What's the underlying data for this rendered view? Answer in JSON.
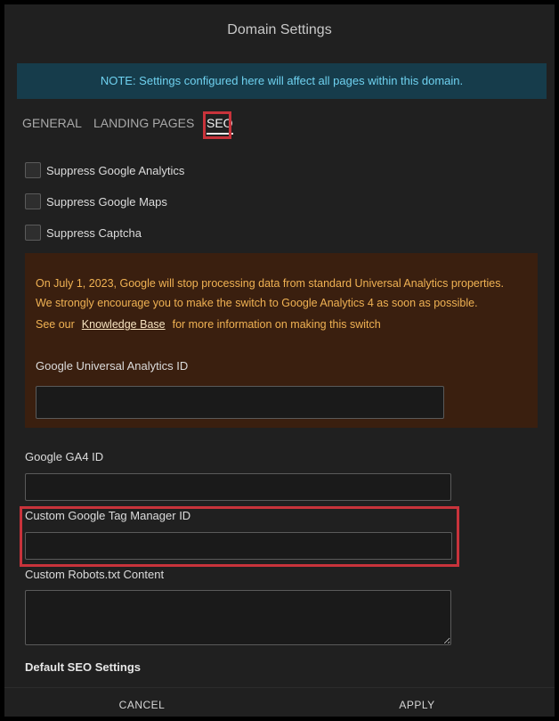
{
  "dialog": {
    "title": "Domain Settings"
  },
  "note": "NOTE: Settings configured here will affect all pages within this domain.",
  "tabs": [
    {
      "label": "GENERAL",
      "active": false
    },
    {
      "label": "LANDING PAGES",
      "active": false
    },
    {
      "label": "SEO",
      "active": true
    }
  ],
  "checkboxes": [
    {
      "label": "Suppress Google Analytics",
      "checked": false
    },
    {
      "label": "Suppress Google Maps",
      "checked": false
    },
    {
      "label": "Suppress Captcha",
      "checked": false
    }
  ],
  "warning": {
    "line1": "On July 1, 2023, Google will stop processing data from standard Universal Analytics properties.",
    "line2": "We strongly encourage you to make the switch to Google Analytics 4 as soon as possible.",
    "line3_prefix": "See our",
    "link": "Knowledge Base",
    "line3_suffix": "for more information on making this switch",
    "ua_label": "Google Universal Analytics ID",
    "ua_value": ""
  },
  "fields": {
    "ga4_label": "Google GA4 ID",
    "ga4_value": "",
    "gtm_label": "Custom Google Tag Manager ID",
    "gtm_value": "",
    "robots_label": "Custom Robots.txt Content",
    "robots_value": ""
  },
  "default_seo_heading": "Default SEO Settings",
  "footer": {
    "cancel": "CANCEL",
    "apply": "APPLY"
  },
  "colors": {
    "dialog_bg": "#202020",
    "note_bg": "#163c4b",
    "note_text": "#6fd2f0",
    "warning_bg": "#3a1f0f",
    "warning_text": "#f0b253",
    "highlight": "#c8333b"
  }
}
